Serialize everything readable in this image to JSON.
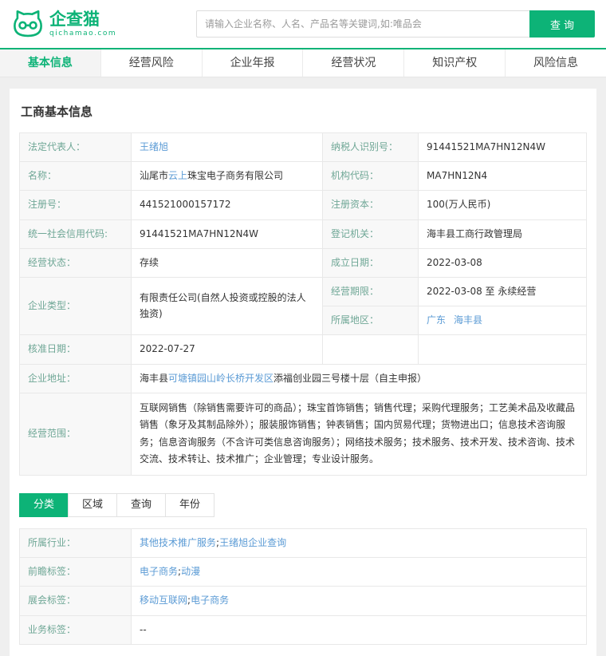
{
  "colors": {
    "brand_green": "#0db377",
    "label_green": "#6fa796",
    "link_blue": "#5b9bd5",
    "page_bg": "#efefef"
  },
  "icons": {
    "logo": "cat-face-with-glasses"
  },
  "header": {
    "logo_title": "企查猫",
    "logo_domain": "qichamao.com",
    "search_placeholder": "请输入企业名称、人名、产品名等关键词,如:唯品会",
    "search_button": "查询"
  },
  "nav": {
    "tabs": [
      {
        "label": "基本信息"
      },
      {
        "label": "经营风险"
      },
      {
        "label": "企业年报"
      },
      {
        "label": "经营状况"
      },
      {
        "label": "知识产权"
      },
      {
        "label": "风险信息"
      }
    ]
  },
  "section_title": "工商基本信息",
  "info": {
    "legal_rep_label": "法定代表人：",
    "legal_rep_value": "王绪旭",
    "tax_id_label": "纳税人识别号：",
    "tax_id_value": "91441521MA7HN12N4W",
    "name_label": "名称：",
    "name_prefix": "汕尾市",
    "name_link": "云上",
    "name_suffix": "珠宝电子商务有限公司",
    "org_code_label": "机构代码：",
    "org_code_value": "MA7HN12N4",
    "reg_no_label": "注册号：",
    "reg_no_value": "441521000157172",
    "reg_capital_label": "注册资本：",
    "reg_capital_value": "100(万人民币)",
    "credit_code_label": "统一社会信用代码:",
    "credit_code_value": "91441521MA7HN12N4W",
    "reg_authority_label": "登记机关：",
    "reg_authority_value": "海丰县工商行政管理局",
    "status_label": "经营状态：",
    "status_value": "存续",
    "establish_date_label": "成立日期：",
    "establish_date_value": "2022-03-08",
    "company_type_label": "企业类型：",
    "company_type_value": "有限责任公司(自然人投资或控股的法人独资)",
    "term_label": "经营期限：",
    "term_value": "2022-03-08 至 永续经营",
    "region_label": "所属地区：",
    "region_province": "广东",
    "region_city": "海丰县",
    "approval_date_label": "核准日期：",
    "approval_date_value": "2022-07-27",
    "address_label": "企业地址：",
    "address_prefix": "海丰县",
    "address_link": "可塘镇园山岭长桥开发区",
    "address_suffix": "添福创业园三号楼十层（自主申报）",
    "scope_label": "经营范围：",
    "scope_value": "互联网销售（除销售需要许可的商品）；珠宝首饰销售；销售代理；采购代理服务；工艺美术品及收藏品销售（象牙及其制品除外）；服装服饰销售；钟表销售；国内贸易代理；货物进出口；信息技术咨询服务；信息咨询服务（不含许可类信息咨询服务）；网络技术服务；技术服务、技术开发、技术咨询、技术交流、技术转让、技术推广；企业管理；专业设计服务。"
  },
  "filter_tabs": [
    "分类",
    "区域",
    "查询",
    "年份"
  ],
  "tags": {
    "industry_label": "所属行业：",
    "industry_link1": "其他技术推广服务",
    "industry_sep": ";",
    "industry_link2": "王绪旭企业查询",
    "foresight_label": "前瞻标签：",
    "foresight_link1": "电子商务",
    "foresight_sep": ";",
    "foresight_link2": "动漫",
    "expo_label": "展会标签：",
    "expo_link1": "移动互联网",
    "expo_sep": ";",
    "expo_link2": "电子商务",
    "business_label": "业务标签：",
    "business_value": "--"
  }
}
